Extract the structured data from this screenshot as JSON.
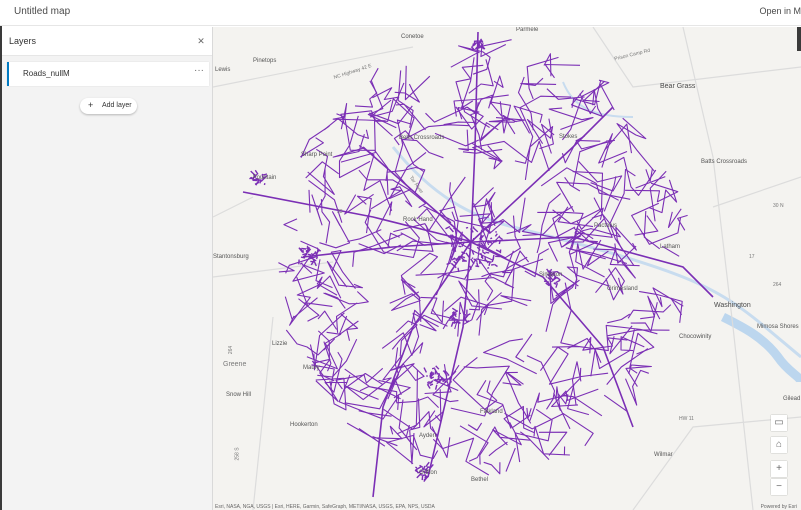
{
  "app": {
    "title": "Untitled map",
    "open_link": "Open in M"
  },
  "panel": {
    "title": "Layers",
    "close_icon": "close-icon",
    "layers": [
      {
        "name": "Roads_nullM"
      }
    ],
    "add_layer_label": "Add layer"
  },
  "map": {
    "route_color": "#7b2fb5",
    "places": [
      "Conetoe",
      "Parmele",
      "Pinetops",
      "Bear Grass",
      "Bells Crossroads",
      "Stokes",
      "Sharp Point",
      "Batts Crossroads",
      "Fountain",
      "Rock Hand",
      "Pactolus",
      "Latham",
      "Grimesland",
      "Simpson",
      "Washington",
      "Mimosa Shores",
      "Chocowinity",
      "Lizzie",
      "Maury",
      "Greene",
      "Snow Hill",
      "Hookerton",
      "Gilead",
      "Wilmar",
      "Ayden",
      "Grifton",
      "Falkland",
      "Bethel",
      "Lewis",
      "Stantonsburg"
    ],
    "road_labels": [
      "NC Highway 42 E",
      "Prison Camp Rd",
      "Tar River",
      "17",
      "33",
      "264",
      "258 S",
      "HW 11",
      "264",
      "30 N"
    ],
    "attribution": "Esri, NASA, NGA, USGS | Esri, HERE, Garmin, SafeGraph, METI/NASA, USGS, EPA, NPS, USDA",
    "powered_by": "Powered by Esri",
    "controls": [
      "screen-icon",
      "home-icon",
      "zoom-in-icon",
      "zoom-out-icon"
    ]
  }
}
